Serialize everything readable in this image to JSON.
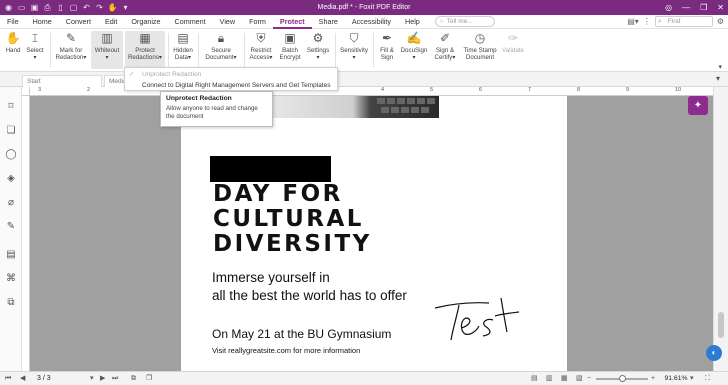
{
  "titlebar": {
    "title": "Media.pdf * - Foxit PDF Editor",
    "quick_access_icons": [
      "app-logo-icon",
      "open-icon",
      "save-icon",
      "print-icon",
      "page-icon",
      "new-icon",
      "undo-icon",
      "redo-icon",
      "hand-tool-icon",
      "dropdown-icon"
    ]
  },
  "menubar": {
    "tabs": [
      "File",
      "Home",
      "Convert",
      "Edit",
      "Organize",
      "Comment",
      "View",
      "Form",
      "Protect",
      "Share",
      "Accessibility",
      "Help"
    ],
    "active_tab": "Protect",
    "tell_me_placeholder": "Tell me...",
    "find_placeholder": "Find"
  },
  "ribbon": {
    "hand": "Hand",
    "select": "Select",
    "mark_for_redaction": [
      "Mark for",
      "Redaction"
    ],
    "whiteout": "Whiteout",
    "protect_redactions": [
      "Protect",
      "Redactions"
    ],
    "hidden_data": [
      "Hidden",
      "Data"
    ],
    "secure_document": [
      "Secure",
      "Document"
    ],
    "restrict_access": [
      "Restrict",
      "Access"
    ],
    "batch_encrypt": [
      "Batch",
      "Encrypt"
    ],
    "settings": "Settings",
    "sensitivity": "Sensitivity",
    "fill_sign": [
      "Fill &",
      "Sign"
    ],
    "docusign": "DocuSign",
    "sign_certify": [
      "Sign &",
      "Certify"
    ],
    "timestamp_document": [
      "Time Stamp",
      "Document"
    ],
    "validate": "Validate"
  },
  "tabs": {
    "start": "Start",
    "media": "Media"
  },
  "dropdown": {
    "items": [
      "Unprotect Redaction",
      "Connect to Digital Right Management Servers and Get Templates"
    ]
  },
  "tooltip": {
    "title": "Unprotect Redaction",
    "body": "Allow anyone to read and change the document"
  },
  "ruler": {
    "ticks": [
      "3",
      "2",
      "1",
      "1",
      "2",
      "3",
      "4",
      "5",
      "6",
      "7",
      "8",
      "9",
      "10"
    ]
  },
  "page": {
    "headline": [
      "DAY FOR",
      "CULTURAL",
      "DIVERSITY"
    ],
    "subtitle": [
      "Immerse yourself in",
      "all the best the world has to offer"
    ],
    "date_line": "On May 21 at the BU Gymnasium",
    "visit_line": "Visit reallygreatsite.com for more information",
    "signature": "Test"
  },
  "statusbar": {
    "page_indicator": "3 / 3",
    "zoom": "91.61%"
  },
  "colors": {
    "brand": "#7a2a7f",
    "accent": "#8e2b8f"
  }
}
